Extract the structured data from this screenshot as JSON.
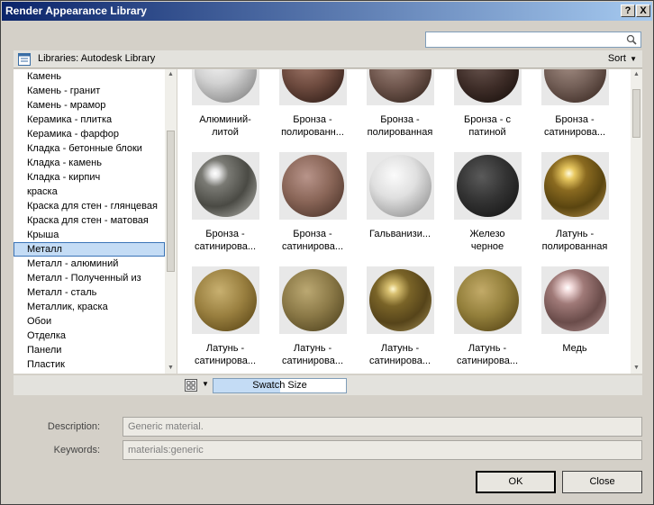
{
  "window": {
    "title": "Render Appearance Library",
    "help_label": "?",
    "close_label": "X"
  },
  "search": {
    "value": ""
  },
  "library": {
    "label": "Libraries: Autodesk Library",
    "sort_label": "Sort"
  },
  "categories": [
    {
      "label": "Камень"
    },
    {
      "label": "Камень - гранит"
    },
    {
      "label": "Камень - мрамор"
    },
    {
      "label": "Керамика - плитка"
    },
    {
      "label": "Керамика - фарфор"
    },
    {
      "label": "Кладка - бетонные блоки"
    },
    {
      "label": "Кладка - камень"
    },
    {
      "label": "Кладка - кирпич"
    },
    {
      "label": "краска"
    },
    {
      "label": "Краска для стен - глянцевая"
    },
    {
      "label": "Краска для стен - матовая"
    },
    {
      "label": "Крыша"
    },
    {
      "label": "Металл"
    },
    {
      "label": "Металл - алюминий"
    },
    {
      "label": "Металл - Полученный из"
    },
    {
      "label": "Металл - сталь"
    },
    {
      "label": "Металлик, краска"
    },
    {
      "label": "Обои"
    },
    {
      "label": "Отделка"
    },
    {
      "label": "Панели"
    },
    {
      "label": "Пластик"
    }
  ],
  "selected_category": "Металл",
  "swatches": [
    {
      "line1": "Алюминий-",
      "line2": "литой",
      "material": "aluminum-cast"
    },
    {
      "line1": "Бронза  -",
      "line2": "полированн...",
      "material": "bronze-dark"
    },
    {
      "line1": "Бронза  -",
      "line2": "полированная",
      "material": "bronze-brown"
    },
    {
      "line1": "Бронза - с",
      "line2": "патиной",
      "material": "bronze-patina"
    },
    {
      "line1": "Бронза  -",
      "line2": "сатинирова...",
      "material": "bronze-satin"
    },
    {
      "line1": "Бронза  -",
      "line2": "сатинирова...",
      "material": "chrome-dark"
    },
    {
      "line1": "Бронза  -",
      "line2": "сатинирова...",
      "material": "bronze-copper"
    },
    {
      "line1": "Гальванизи...",
      "line2": "",
      "material": "galvanized"
    },
    {
      "line1": "Железо",
      "line2": "черное",
      "material": "iron-black"
    },
    {
      "line1": "Латунь  -",
      "line2": "полированная",
      "material": "brass-polished"
    },
    {
      "line1": "Латунь  -",
      "line2": "сатинирова...",
      "material": "brass-satin"
    },
    {
      "line1": "Латунь  -",
      "line2": "сатинирова...",
      "material": "brass-satin-2"
    },
    {
      "line1": "Латунь  -",
      "line2": "сатинирова...",
      "material": "brass-satin-3"
    },
    {
      "line1": "Латунь  -",
      "line2": "сатинирова...",
      "material": "brass-satin-4"
    },
    {
      "line1": "Медь",
      "line2": "",
      "material": "copper"
    }
  ],
  "swatch_toolbar": {
    "size_label": "Swatch Size"
  },
  "details": {
    "description_label": "Description:",
    "description_value": "Generic material.",
    "keywords_label": "Keywords:",
    "keywords_value": "materials:generic"
  },
  "buttons": {
    "ok": "OK",
    "close": "Close"
  }
}
